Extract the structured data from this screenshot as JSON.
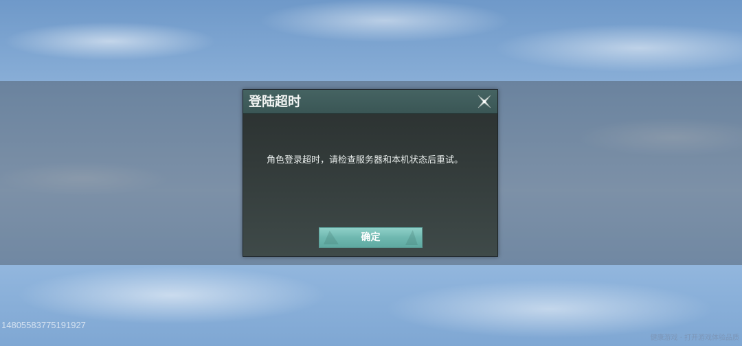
{
  "dialog": {
    "title": "登陆超时",
    "message": "角色登录超时，请检查服务器和本机状态后重试。",
    "confirm_label": "确定",
    "close_icon": "close-x-icon"
  },
  "overlay": {
    "uid": "1480558377519​1927",
    "footer_note": "健康游戏 · 打开游戏体验品质"
  },
  "colors": {
    "header": "#456362",
    "dialog_body": "#333b3a",
    "button": "#6fb8b0"
  }
}
